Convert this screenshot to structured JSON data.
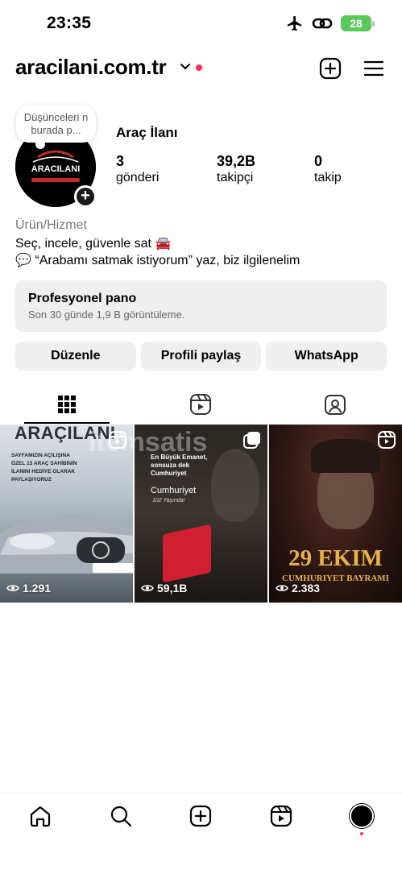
{
  "status": {
    "time": "23:35",
    "battery": "28"
  },
  "header": {
    "username": "aracilani.com.tr"
  },
  "profile": {
    "note": "Düşünceleri n burada p...",
    "name": "Araç İlanı",
    "avatar_text": "ARACILANI",
    "stats": [
      {
        "value": "3",
        "label": "gönderi"
      },
      {
        "value": "39,2B",
        "label": "takipçi"
      },
      {
        "value": "0",
        "label": "takip"
      }
    ],
    "category": "Ürün/Hizmet",
    "bio_line1": "Seç, incele, güvenle sat 🚘",
    "bio_line2": "💬 “Arabamı satmak istiyorum” yaz, biz ilgilenelim"
  },
  "pro_panel": {
    "title": "Profesyonel pano",
    "subtitle": "Son 30 günde 1,9 B görüntüleme."
  },
  "buttons": {
    "edit": "Düzenle",
    "share": "Profili paylaş",
    "whatsapp": "WhatsApp"
  },
  "posts": [
    {
      "views": "1.291",
      "title": "ARAÇILANI",
      "text": "SAYFAMIZIN AÇILIŞINA ÖZEL 15 ARAÇ SAHİBİNİN İLANINI HEDİYE OLARAK PAYLAŞIYORUZ"
    },
    {
      "views": "59,1B",
      "text": "En Büyük Emanet, sonsuza dek Cumhuriyet",
      "script": "Cumhuriyet",
      "sub": "102 Yaşında!"
    },
    {
      "views": "2.383",
      "big": "29 EKIM",
      "small": "CUMHURIYET BAYRAMI"
    }
  ],
  "watermark": "itemsatis"
}
